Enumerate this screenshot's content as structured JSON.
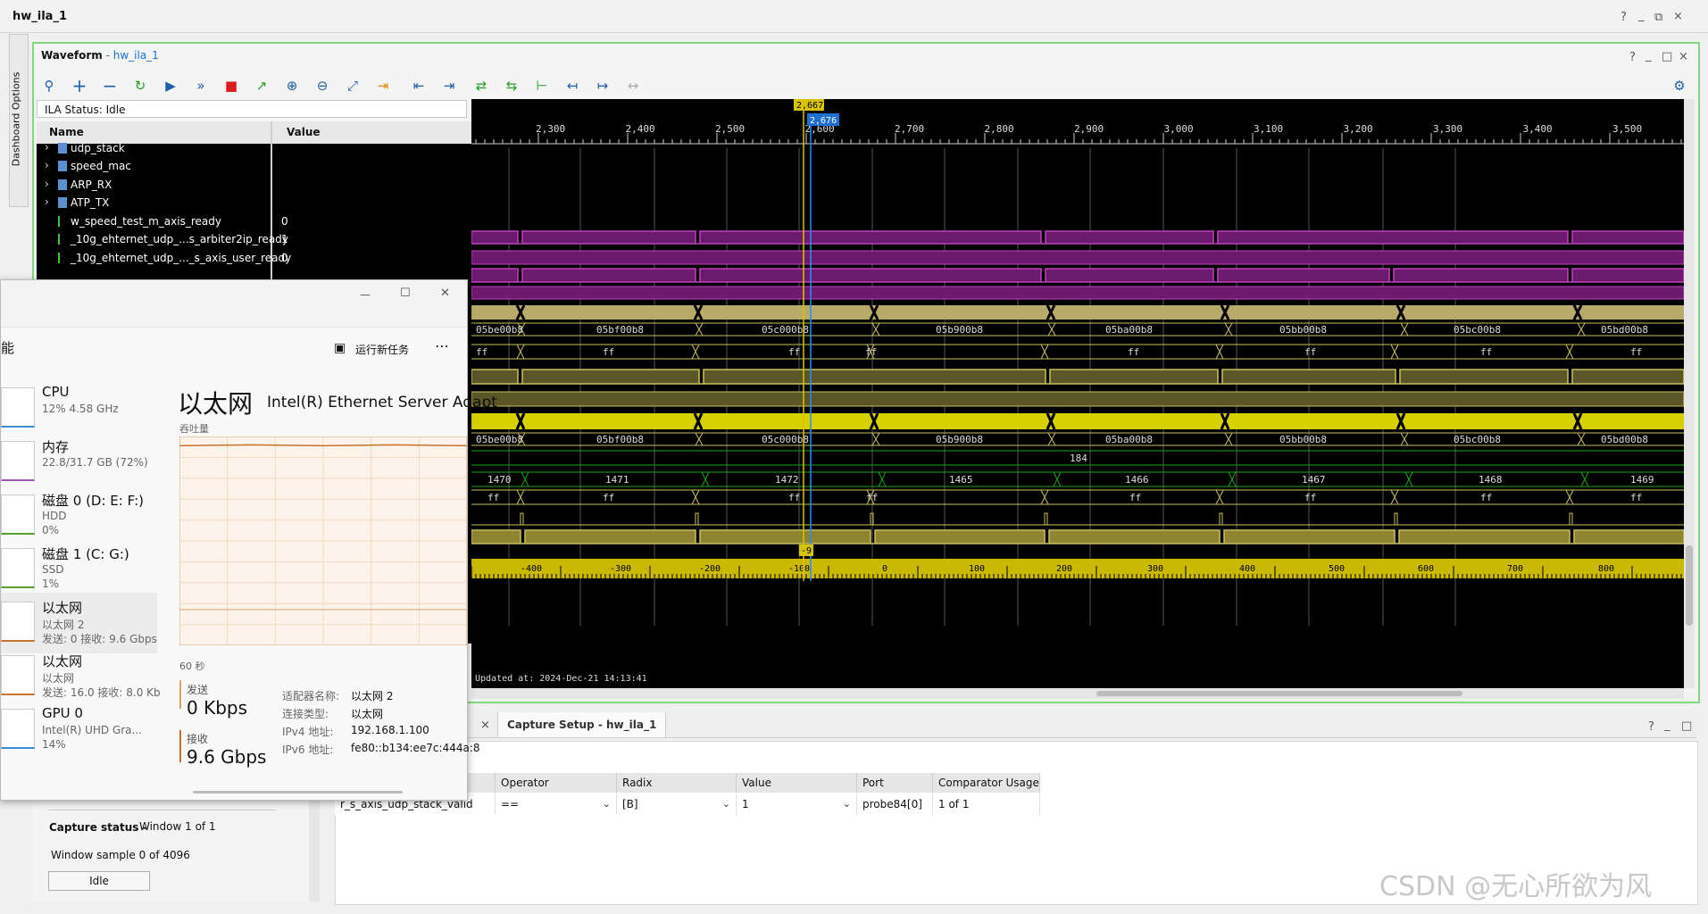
{
  "app": {
    "title": "hw_ila_1",
    "controls": [
      "?",
      "_",
      "⧉",
      "×"
    ]
  },
  "side_tab": {
    "label": "Dashboard Options"
  },
  "waveform": {
    "title": "Waveform",
    "title_sep": " - ",
    "subtitle": "hw_ila_1",
    "controls": [
      "?",
      "_",
      "□",
      "×"
    ],
    "ila_status": "ILA Status: Idle",
    "columns": {
      "name": "Name",
      "value": "Value"
    },
    "signals": [
      {
        "name": "udp_stack",
        "value": "",
        "type": "group"
      },
      {
        "name": "speed_mac",
        "value": "",
        "type": "group"
      },
      {
        "name": "ARP_RX",
        "value": "",
        "type": "group"
      },
      {
        "name": "ATP_TX",
        "value": "",
        "type": "group"
      },
      {
        "name": "w_speed_test_m_axis_ready",
        "value": "0",
        "type": "bit"
      },
      {
        "name": "_10g_ehternet_udp_...s_arbiter2ip_ready",
        "value": "1",
        "type": "bit"
      },
      {
        "name": "_10g_ehternet_udp_..._s_axis_user_ready",
        "value": "0",
        "type": "bit"
      }
    ],
    "cursor_top": "2,667",
    "cursor_blue": "2,676",
    "cursor_bottom": "-9",
    "ruler_top": [
      "2,300",
      "2,400",
      "2,500",
      "2,600",
      "2,700",
      "2,800",
      "2,900",
      "3,000",
      "3,100",
      "3,200",
      "3,300",
      "3,400",
      "3,500"
    ],
    "ruler_bottom": [
      "-400",
      "-300",
      "-200",
      "-100",
      "0",
      "100",
      "200",
      "300",
      "400",
      "500",
      "600",
      "700",
      "800"
    ],
    "bus_addr": [
      "05be00b8",
      "05bf00b8",
      "05c000b8",
      "05b900b8",
      "05ba00b8",
      "05bb00b8",
      "05bc00b8",
      "05bd00b8"
    ],
    "bus_ff": [
      "ff",
      "ff",
      "ff",
      "ff",
      "ff",
      "ff",
      "ff",
      "ff"
    ],
    "bus_len_const": "184",
    "bus_count": [
      "1470",
      "1471",
      "1472",
      "1465",
      "1466",
      "1467",
      "1468",
      "1469"
    ],
    "updated": "Updated at: 2024-Dec-21 14:13:41",
    "colors": {
      "purple": "#7a1f7d",
      "olive": "#b8ab6a",
      "yellow": "#d6d000",
      "green": "#1aa31a",
      "bg": "#000000"
    }
  },
  "taskmgr": {
    "controls": [
      "—",
      "☐",
      "✕"
    ],
    "header_partial": "能",
    "run_new_task": "运行新任务",
    "more": "⋯",
    "items": [
      {
        "name": "CPU",
        "sub1": "12%  4.58 GHz",
        "sub2": ""
      },
      {
        "name": "内存",
        "sub1": "22.8/31.7 GB (72%)",
        "sub2": ""
      },
      {
        "name": "磁盘 0 (D: E: F:)",
        "sub1": "HDD",
        "sub2": "0%"
      },
      {
        "name": "磁盘 1 (C: G:)",
        "sub1": "SSD",
        "sub2": "1%"
      },
      {
        "name": "以太网",
        "sub1": "以太网 2",
        "sub2": "发送: 0 接收: 9.6 Gbps"
      },
      {
        "name": "以太网",
        "sub1": "以太网",
        "sub2": "发送: 16.0 接收: 8.0 Kb"
      },
      {
        "name": "GPU 0",
        "sub1": "Intel(R) UHD Gra...",
        "sub2": "14%"
      }
    ],
    "detail_title": "以太网",
    "detail_adapter": "Intel(R) Ethernet Server Adapt",
    "throughput_label": "吞吐量",
    "time_span": "60 秒",
    "send_label": "发送",
    "send_value": "0 Kbps",
    "recv_label": "接收",
    "recv_value": "9.6 Gbps",
    "props": [
      {
        "k": "适配器名称:",
        "v": "以太网 2"
      },
      {
        "k": "连接类型:",
        "v": "以太网"
      },
      {
        "k": "IPv4 地址:",
        "v": "192.168.1.100"
      },
      {
        "k": "IPv6 地址:",
        "v": "fe80::b134:ee7c:444a:8"
      }
    ],
    "recv_level": 0.96
  },
  "capture": {
    "tab_close": "×",
    "tab_label": "Capture Setup - hw_ila_1",
    "controls": [
      "?",
      "_",
      "□"
    ],
    "status_label": "Capture status -",
    "status_window": "Window 1 of 1",
    "window_sample": "Window sample 0 of 4096",
    "state_button": "Idle",
    "table_headers": [
      "Operator",
      "Radix",
      "Value",
      "Port",
      "Comparator Usage"
    ],
    "row": {
      "probe": "r_s_axis_udp_stack_valid",
      "operator": "==",
      "radix": "[B]",
      "value": "1",
      "port": "probe84[0]",
      "usage": "1 of 1"
    }
  },
  "watermark": "CSDN @无心所欲为风"
}
